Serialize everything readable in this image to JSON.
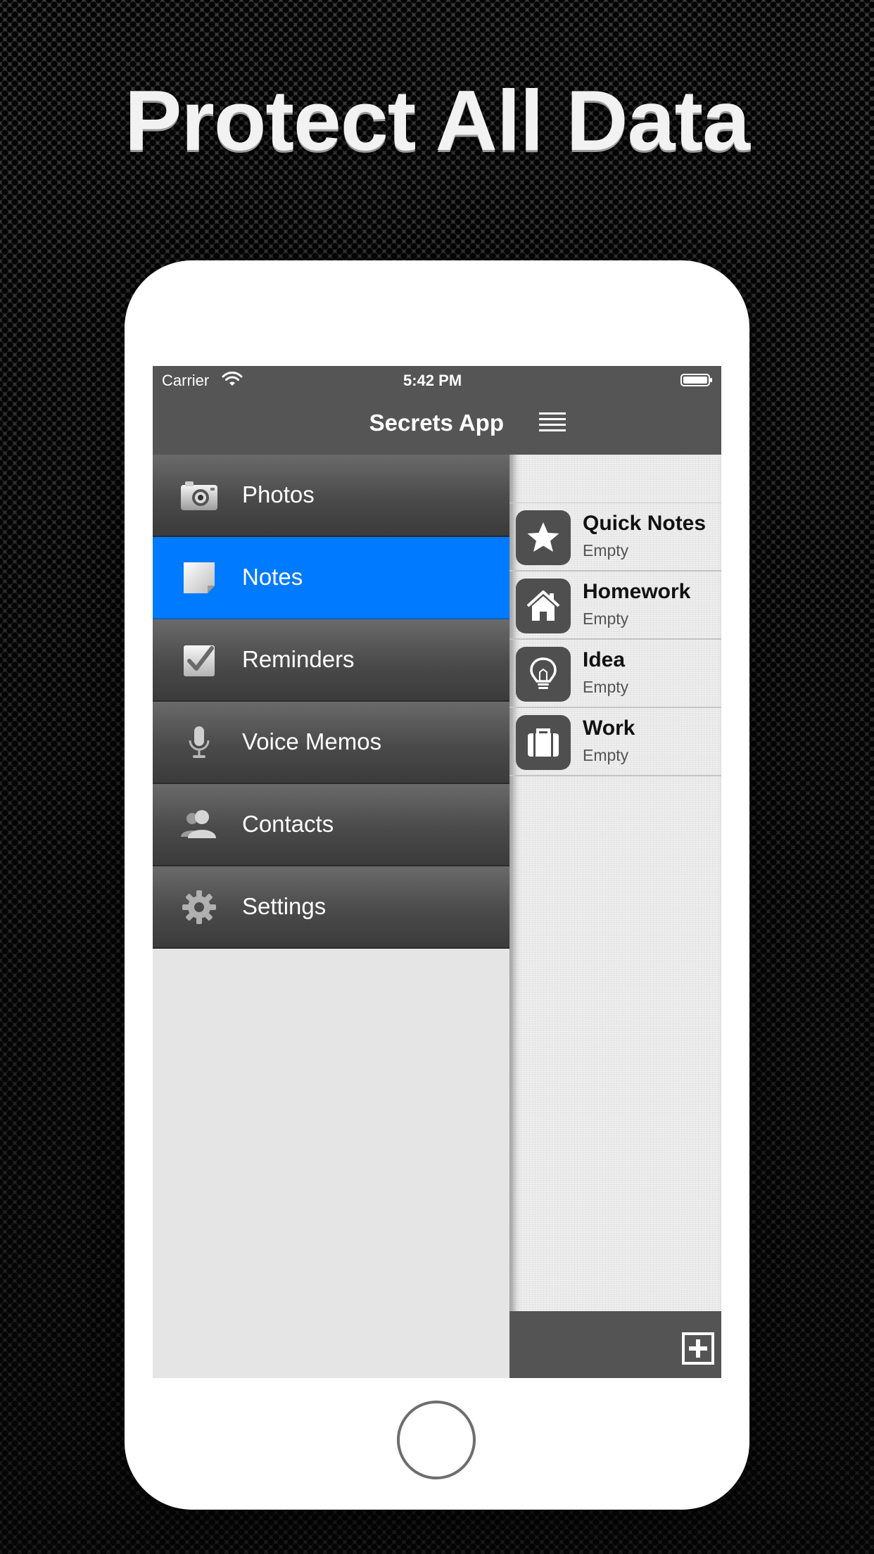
{
  "headline": "Protect All Data",
  "status_bar": {
    "carrier": "Carrier",
    "time": "5:42 PM"
  },
  "menu": {
    "title": "Secrets App",
    "items": [
      {
        "label": "Photos",
        "icon": "camera-icon",
        "active": false
      },
      {
        "label": "Notes",
        "icon": "note-icon",
        "active": true
      },
      {
        "label": "Reminders",
        "icon": "checkbox-icon",
        "active": false
      },
      {
        "label": "Voice Memos",
        "icon": "microphone-icon",
        "active": false
      },
      {
        "label": "Contacts",
        "icon": "contacts-icon",
        "active": false
      },
      {
        "label": "Settings",
        "icon": "gear-icon",
        "active": false
      }
    ]
  },
  "notes_panel": {
    "categories": [
      {
        "name": "Quick Notes",
        "count": "Empty",
        "icon": "star-icon"
      },
      {
        "name": "Homework",
        "count": "Empty",
        "icon": "house-icon"
      },
      {
        "name": "Idea",
        "count": "Empty",
        "icon": "lightbulb-icon"
      },
      {
        "name": "Work",
        "count": "Empty",
        "icon": "briefcase-icon"
      }
    ]
  },
  "colors": {
    "accent_blue": "#007AFE",
    "header_gray": "#555555",
    "background_light": "#E5E5E5"
  }
}
